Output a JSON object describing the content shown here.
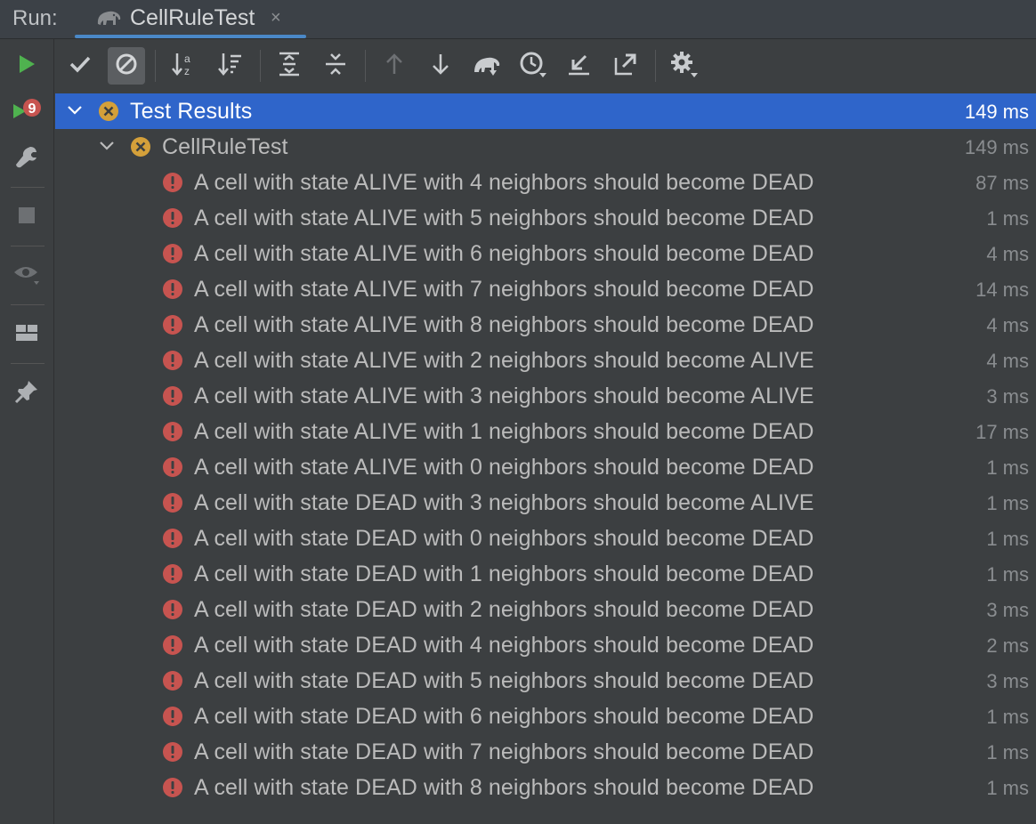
{
  "header": {
    "run_label": "Run:",
    "tab_title": "CellRuleTest",
    "tab_close": "×"
  },
  "colors": {
    "accent": "#2f65ca",
    "tab_underline": "#4a88c7",
    "fail_red": "#c75450",
    "ignored_orange": "#d4a03a",
    "run_green": "#4fb24f"
  },
  "sidebar": {
    "items": [
      {
        "icon": "run-icon"
      },
      {
        "icon": "rerun-failed-icon",
        "badge": "9"
      },
      {
        "icon": "wrench-icon"
      },
      {
        "icon": "stop-icon"
      },
      {
        "icon": "eye-icon"
      },
      {
        "icon": "layout-icon"
      },
      {
        "icon": "pin-icon"
      }
    ]
  },
  "toolbar": {
    "buttons": [
      {
        "icon": "show-passed-icon"
      },
      {
        "icon": "show-ignored-icon"
      },
      {
        "icon": "sort-alphabetically-icon"
      },
      {
        "icon": "sort-by-duration-icon"
      },
      {
        "icon": "expand-all-icon"
      },
      {
        "icon": "collapse-all-icon"
      },
      {
        "icon": "previous-failed-icon"
      },
      {
        "icon": "next-failed-icon"
      },
      {
        "icon": "gradle-icon"
      },
      {
        "icon": "history-icon"
      },
      {
        "icon": "import-tests-icon"
      },
      {
        "icon": "export-tests-icon"
      },
      {
        "icon": "settings-icon"
      }
    ]
  },
  "tree": {
    "root": {
      "label": "Test Results",
      "time": "149 ms"
    },
    "suite": {
      "label": "CellRuleTest",
      "time": "149 ms"
    },
    "tests": [
      {
        "label": "A cell with state ALIVE with 4 neighbors should become DEAD",
        "time": "87 ms"
      },
      {
        "label": "A cell with state ALIVE with 5 neighbors should become DEAD",
        "time": "1 ms"
      },
      {
        "label": "A cell with state ALIVE with 6 neighbors should become DEAD",
        "time": "4 ms"
      },
      {
        "label": "A cell with state ALIVE with 7 neighbors should become DEAD",
        "time": "14 ms"
      },
      {
        "label": "A cell with state ALIVE with 8 neighbors should become DEAD",
        "time": "4 ms"
      },
      {
        "label": "A cell with state ALIVE with 2 neighbors should become ALIVE",
        "time": "4 ms"
      },
      {
        "label": "A cell with state ALIVE with 3 neighbors should become ALIVE",
        "time": "3 ms"
      },
      {
        "label": "A cell with state ALIVE with 1 neighbors should become DEAD",
        "time": "17 ms"
      },
      {
        "label": "A cell with state ALIVE with 0 neighbors should become DEAD",
        "time": "1 ms"
      },
      {
        "label": "A cell with state DEAD with 3 neighbors should become ALIVE",
        "time": "1 ms"
      },
      {
        "label": "A cell with state DEAD with 0 neighbors should become DEAD",
        "time": "1 ms"
      },
      {
        "label": "A cell with state DEAD with 1 neighbors should become DEAD",
        "time": "1 ms"
      },
      {
        "label": "A cell with state DEAD with 2 neighbors should become DEAD",
        "time": "3 ms"
      },
      {
        "label": "A cell with state DEAD with 4 neighbors should become DEAD",
        "time": "2 ms"
      },
      {
        "label": "A cell with state DEAD with 5 neighbors should become DEAD",
        "time": "3 ms"
      },
      {
        "label": "A cell with state DEAD with 6 neighbors should become DEAD",
        "time": "1 ms"
      },
      {
        "label": "A cell with state DEAD with 7 neighbors should become DEAD",
        "time": "1 ms"
      },
      {
        "label": "A cell with state DEAD with 8 neighbors should become DEAD",
        "time": "1 ms"
      }
    ]
  }
}
